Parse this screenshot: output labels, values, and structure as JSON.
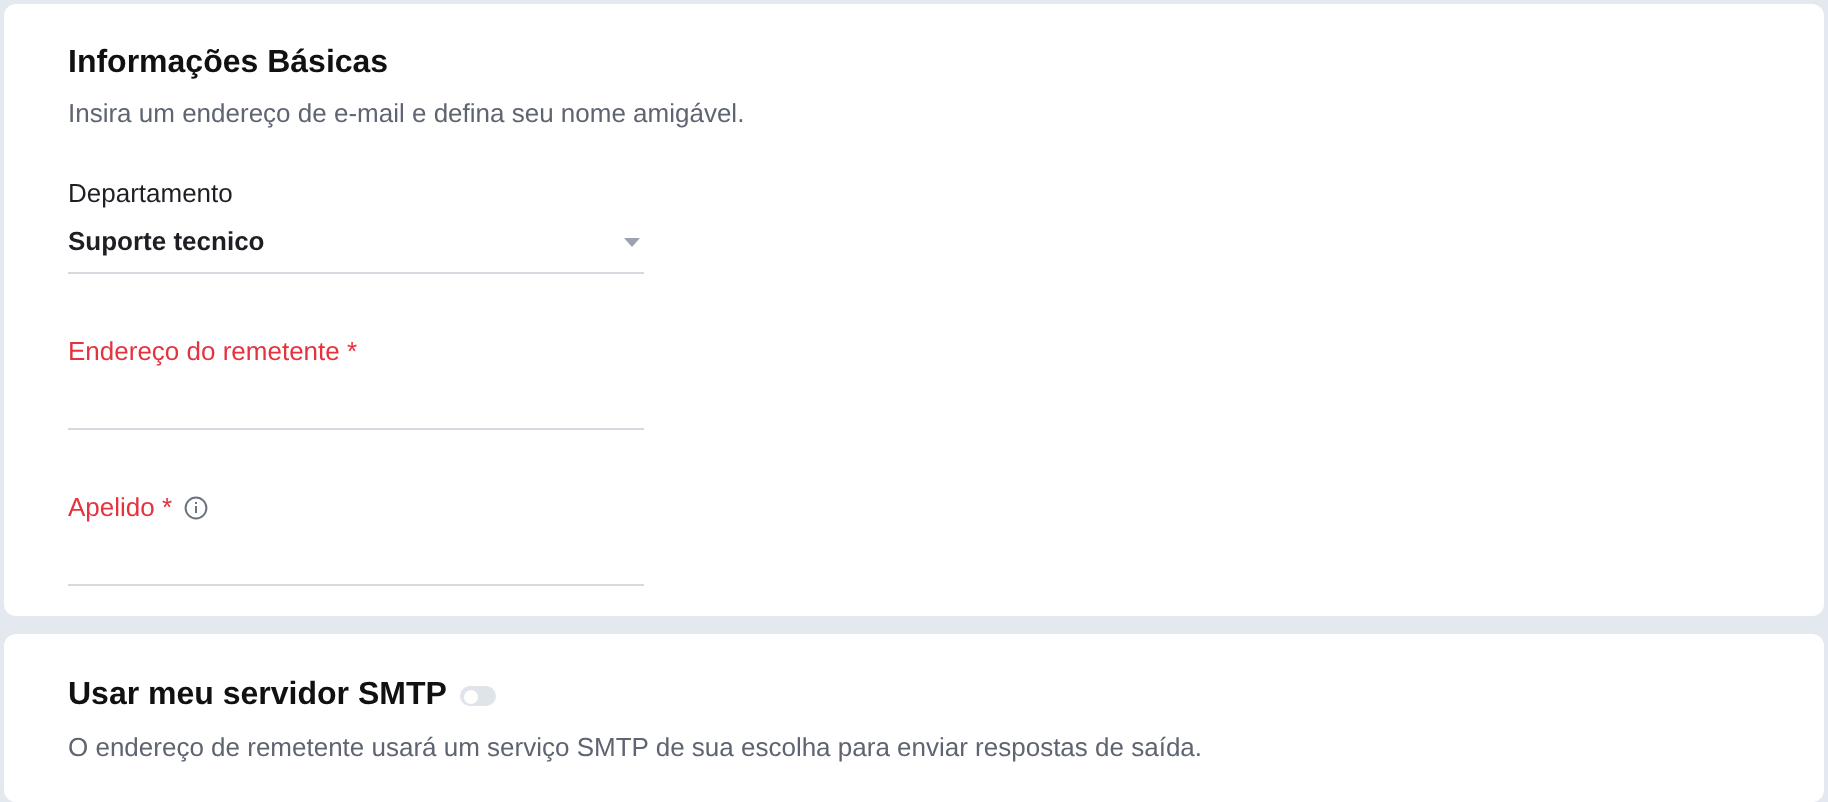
{
  "basic_info": {
    "title": "Informações Básicas",
    "subtitle": "Insira um endereço de e-mail e defina seu nome amigável.",
    "fields": [
      {
        "kind": "select",
        "label": "Departamento",
        "value": "Suporte tecnico",
        "required": false,
        "info": false
      },
      {
        "kind": "text",
        "label": "Endereço do remetente",
        "required": true,
        "required_mark": "*",
        "info": false
      },
      {
        "kind": "text",
        "label": "Apelido",
        "required": true,
        "required_mark": "*",
        "info": true
      }
    ]
  },
  "smtp": {
    "title": "Usar meu servidor SMTP",
    "on": false,
    "description": "O endereço de remetente usará um serviço SMTP de sua escolha para enviar respostas de saída."
  }
}
